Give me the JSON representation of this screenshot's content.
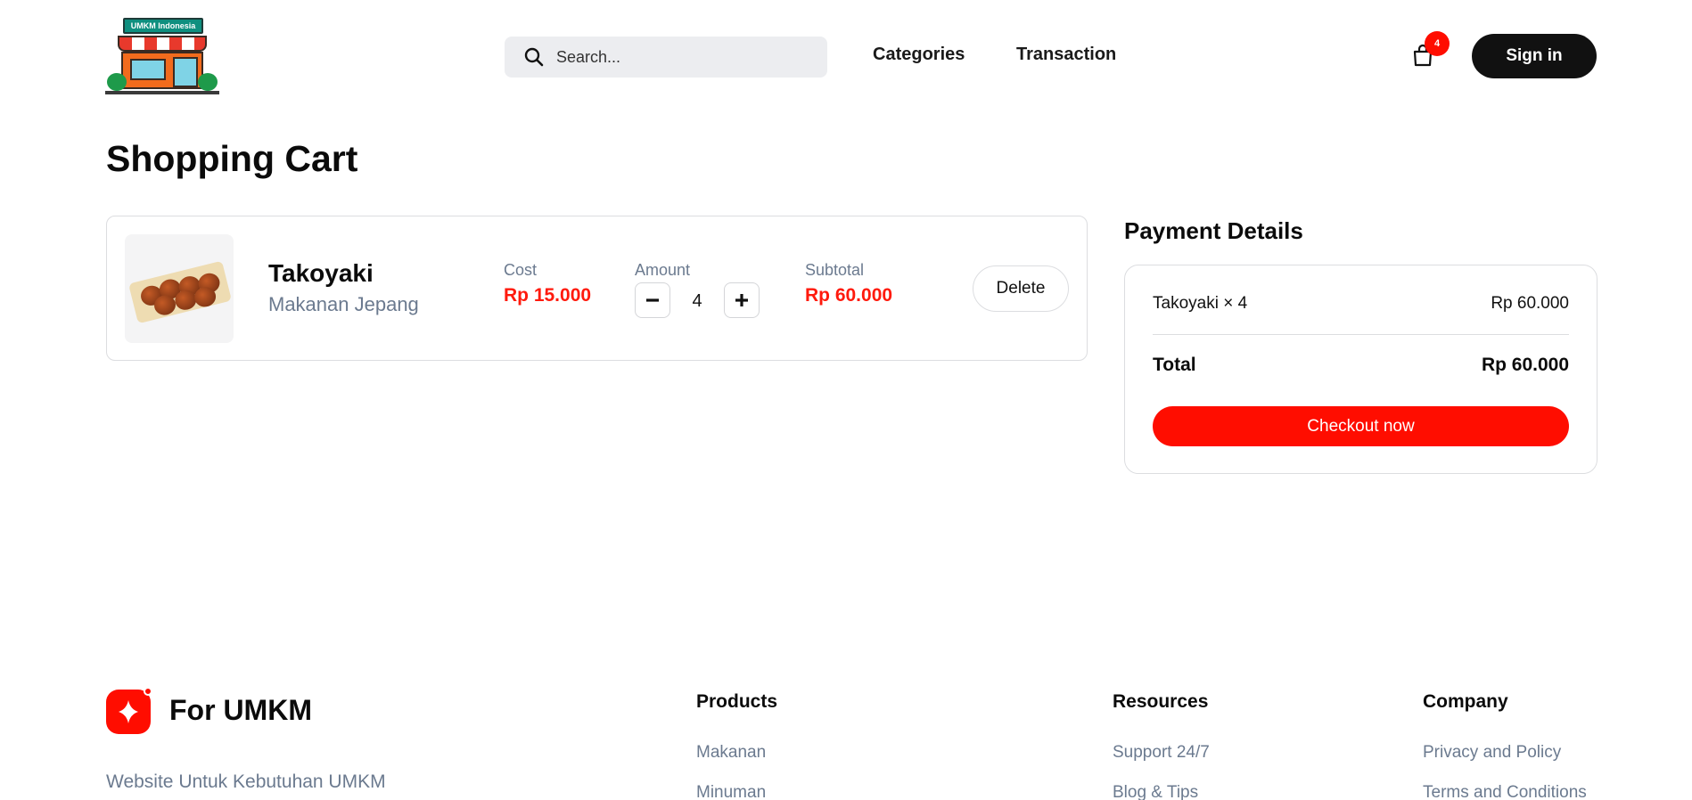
{
  "header": {
    "logo_text": "UMKM Indonesia",
    "search_placeholder": "Search...",
    "nav": {
      "categories": "Categories",
      "transaction": "Transaction"
    },
    "cart_count": "4",
    "signin_label": "Sign in"
  },
  "page_title": "Shopping Cart",
  "cart": {
    "item": {
      "name": "Takoyaki",
      "category": "Makanan Jepang",
      "cost_label": "Cost",
      "cost": "Rp 15.000",
      "amount_label": "Amount",
      "amount": "4",
      "subtotal_label": "Subtotal",
      "subtotal": "Rp 60.000",
      "delete_label": "Delete"
    }
  },
  "payment": {
    "title": "Payment Details",
    "line_item": "Takoyaki × 4",
    "line_value": "Rp 60.000",
    "total_label": "Total",
    "total_value": "Rp 60.000",
    "checkout_label": "Checkout now"
  },
  "footer": {
    "brand": "For UMKM",
    "tagline": "Website Untuk Kebutuhan UMKM",
    "columns": [
      {
        "title": "Products",
        "links": [
          "Makanan",
          "Minuman"
        ]
      },
      {
        "title": "Resources",
        "links": [
          "Support 24/7",
          "Blog & Tips"
        ]
      },
      {
        "title": "Company",
        "links": [
          "Privacy and Policy",
          "Terms and Conditions"
        ]
      }
    ]
  },
  "colors": {
    "accent": "#ff0d00",
    "dark": "#111111",
    "muted": "#6b7a8f"
  }
}
